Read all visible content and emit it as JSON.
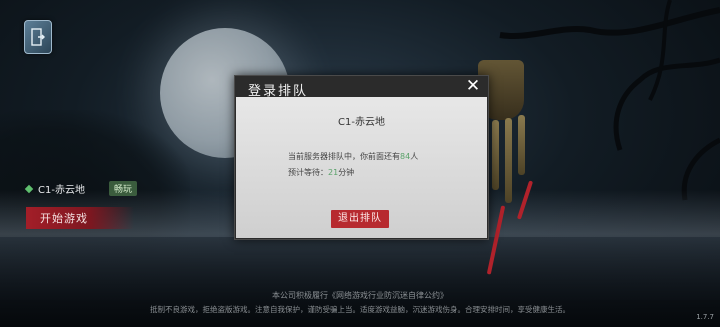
{
  "left_menu": {
    "server_name": "C1-赤云地",
    "server_status": "畅玩",
    "start_button": "开始游戏"
  },
  "dialog": {
    "title": "登录排队",
    "server_title": "C1-赤云地",
    "queue_prefix": "当前服务器排队中，你前面还有",
    "queue_count": "84",
    "queue_suffix": "人",
    "wait_prefix": "预计等待：",
    "wait_minutes": "21",
    "wait_suffix": "分钟",
    "exit_button": "退出排队"
  },
  "footer": {
    "line1": "本公司积极履行《网络游戏行业防沉迷自律公约》",
    "line2": "抵制不良游戏，拒绝盗版游戏。注意自我保护，谨防受骗上当。适度游戏益脑，沉迷游戏伤身。合理安排时间，享受健康生活。"
  },
  "version": "1.7.7",
  "icons": {
    "corner": "exit-door-icon",
    "close": "close-icon"
  },
  "colors": {
    "accent_red": "#b72a2f",
    "highlight_green": "#5aa26a"
  }
}
